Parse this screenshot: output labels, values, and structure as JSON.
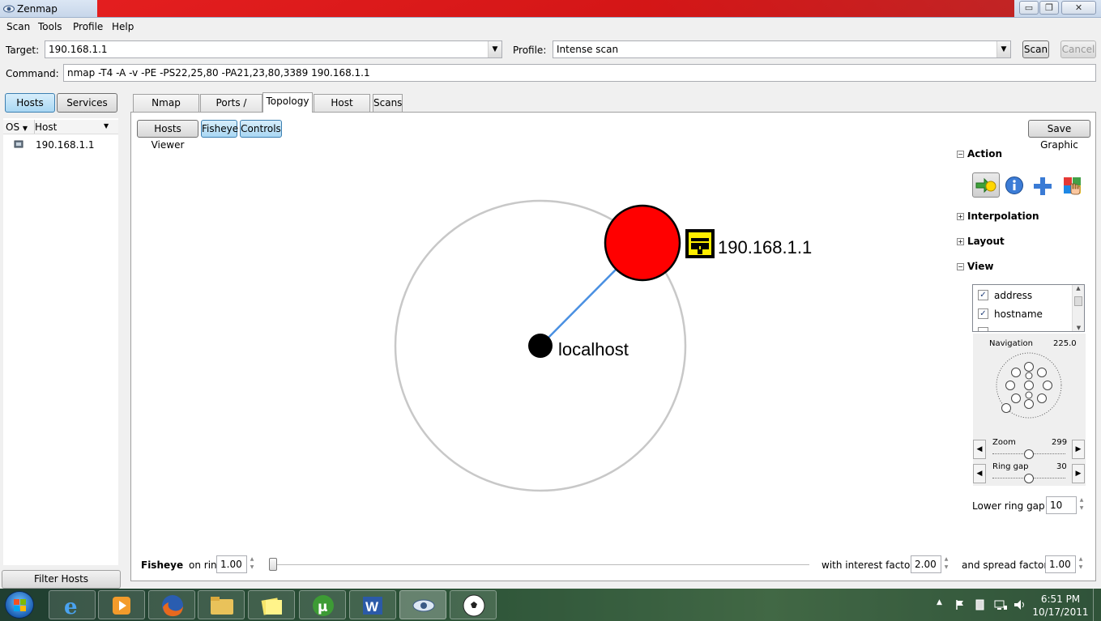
{
  "window": {
    "title": "Zenmap",
    "minimize": "▭",
    "maximize": "❐",
    "close": "✕"
  },
  "menu": [
    "Scan",
    "Tools",
    "Profile",
    "Help"
  ],
  "target": {
    "label": "Target:",
    "value": "190.168.1.1"
  },
  "profile": {
    "label": "Profile:",
    "value": "Intense scan"
  },
  "scan_button": "Scan",
  "cancel_button": "Cancel",
  "command": {
    "label": "Command:",
    "value": "nmap -T4 -A -v -PE -PS22,25,80 -PA21,23,80,3389 190.168.1.1"
  },
  "left": {
    "hosts_button": "Hosts",
    "services_button": "Services",
    "col_os": "OS",
    "col_host": "Host",
    "hosts": [
      "190.168.1.1"
    ],
    "filter_button": "Filter Hosts"
  },
  "tabs": [
    "Nmap Output",
    "Ports / Hosts",
    "Topology",
    "Host Details",
    "Scans"
  ],
  "topology": {
    "hosts_viewer": "Hosts Viewer",
    "fisheye": "Fisheye",
    "controls": "Controls",
    "save_graphic": "Save Graphic",
    "node_host": "190.168.1.1",
    "node_local": "localhost",
    "colors": {
      "host": "#ff0000",
      "local": "#000000",
      "edge": "#4a90e2",
      "ring": "#c8c8c8"
    }
  },
  "controls": {
    "action": "Action",
    "interpolation": "Interpolation",
    "layout": "Layout",
    "view": "View",
    "view_items": [
      {
        "label": "address",
        "checked": true
      },
      {
        "label": "hostname",
        "checked": true
      }
    ],
    "navigation": "Navigation",
    "navigation_value": "225.0",
    "zoom": "Zoom",
    "zoom_value": "299",
    "ring_gap": "Ring gap",
    "ring_gap_value": "30",
    "lower_ring_gap": "Lower ring gap",
    "lower_ring_gap_value": "10"
  },
  "fisheye_bar": {
    "fisheye_bold": "Fisheye",
    "on_ring": "on ring",
    "ring_value": "1.00",
    "interest_label": "with interest factor",
    "interest_value": "2.00",
    "spread_label": "and spread factor",
    "spread_value": "1.00"
  },
  "taskbar": {
    "time": "6:51 PM",
    "date": "10/17/2011"
  }
}
